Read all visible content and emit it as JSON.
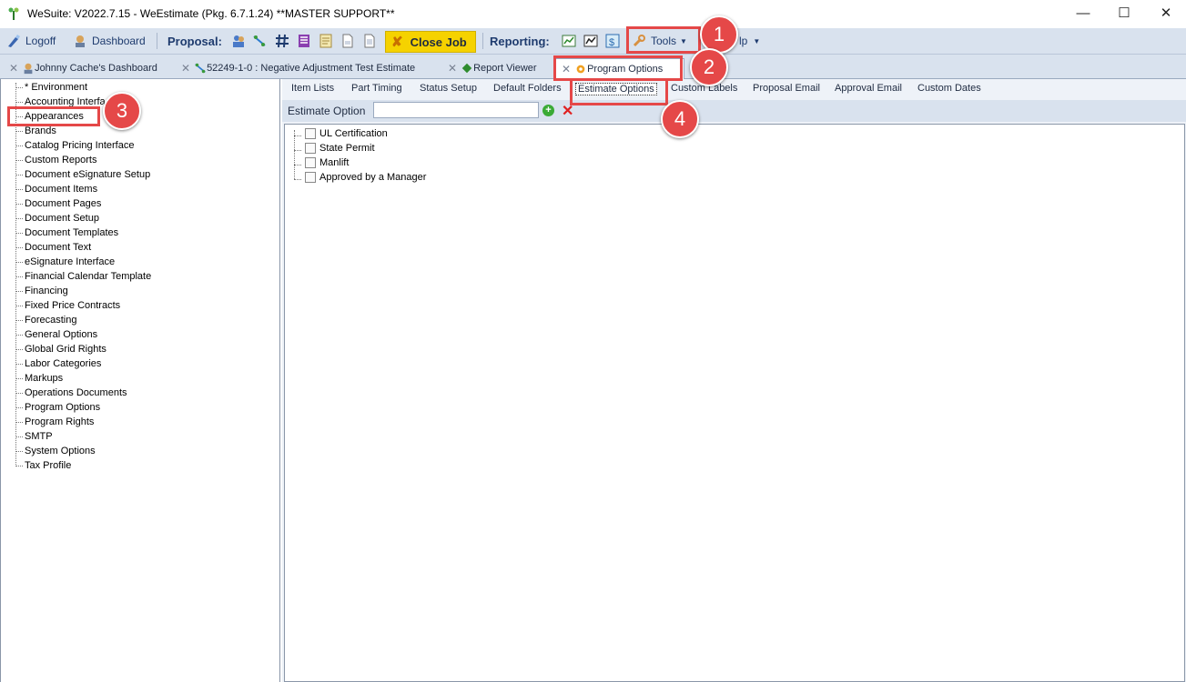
{
  "window": {
    "title": "WeSuite: V2022.7.15 - WeEstimate (Pkg. 6.7.1.24) **MASTER SUPPORT**",
    "minimize": "—",
    "maximize": "☐",
    "close": "✕"
  },
  "toolbar": {
    "logoff": "Logoff",
    "dashboard": "Dashboard",
    "proposal": "Proposal:",
    "close_job": "Close Job",
    "reporting": "Reporting:",
    "tools": "Tools",
    "help": "lp"
  },
  "tabs": [
    {
      "label": "Johnny Cache's Dashboard"
    },
    {
      "label": "52249-1-0 : Negative Adjustment Test Estimate"
    },
    {
      "label": "Report Viewer"
    },
    {
      "label": "Program Options"
    }
  ],
  "tree": [
    "* Environment",
    "Accounting Interfa",
    "Appearances",
    "Brands",
    "Catalog Pricing Interface",
    "Custom Reports",
    "Document eSignature Setup",
    "Document Items",
    "Document Pages",
    "Document Setup",
    "Document Templates",
    "Document Text",
    "eSignature Interface",
    "Financial Calendar Template",
    "Financing",
    "Fixed Price Contracts",
    "Forecasting",
    "General Options",
    "Global Grid Rights",
    "Labor Categories",
    "Markups",
    "Operations Documents",
    "Program Options",
    "Program Rights",
    "SMTP",
    "System Options",
    "Tax Profile"
  ],
  "subtabs": [
    "Item Lists",
    "Part Timing",
    "Status Setup",
    "Default Folders",
    "Estimate Options",
    "Custom Labels",
    "Proposal Email",
    "Approval Email",
    "Custom Dates"
  ],
  "estimate_option": {
    "label": "Estimate Option",
    "value": ""
  },
  "options": [
    "UL Certification",
    "State Permit",
    "Manlift",
    "Approved by a Manager"
  ],
  "annotations": [
    "1",
    "2",
    "3",
    "4"
  ],
  "colors": {
    "accent": "#e54848",
    "toolbar": "#d9e2ee",
    "close_job": "#f5d200"
  }
}
